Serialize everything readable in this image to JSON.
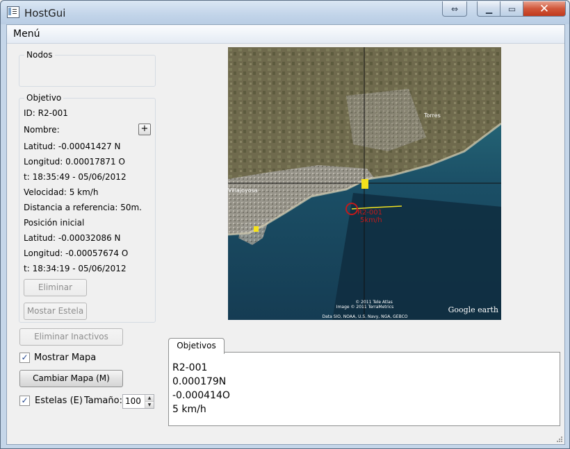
{
  "window": {
    "title": "HostGui"
  },
  "menu": {
    "items": [
      "Menú"
    ]
  },
  "nodos": {
    "title": "Nodos"
  },
  "objetivo": {
    "title": "Objetivo",
    "id": "ID: R2-001",
    "nombre": "Nombre:",
    "add_label": "+",
    "latitud": "Latitud: -0.00041427 N",
    "longitud": "Longitud: 0.00017871 O",
    "tiempo": "t: 18:35:49 - 05/06/2012",
    "velocidad": "Velocidad: 5 km/h",
    "distancia": "Distancia a referencia: 50m.",
    "posicion_inicial": "Posición inicial",
    "latitud_inicial": "Latitud: -0.00032086 N",
    "longitud_inicial": "Longitud: -0.00057674 O",
    "tiempo_inicial": "t: 18:34:19 - 05/06/2012",
    "eliminar_label": "Eliminar",
    "mostrar_estela_label": "Mostar Estela"
  },
  "controls": {
    "eliminar_inactivos_label": "Eliminar Inactivos",
    "mostrar_mapa_label": "Mostrar Mapa",
    "mostrar_mapa_checked": true,
    "cambiar_mapa_label": "Cambiar Mapa (M)",
    "estelas_label": "Estelas (E)",
    "estelas_checked": true,
    "tamano_label": "Tamaño:",
    "tamano_value": "100"
  },
  "map": {
    "place_1": "Villajoyosa",
    "place_2": "Torres",
    "marker_label": "R2-001",
    "speed_label": "5km/h",
    "copyright_1": "© 2011 Tele Atlas",
    "copyright_2": "Image © 2011 TerraMetrics",
    "copyright_3": "Data SIO, NOAA, U.S. Navy, NGA, GEBCO",
    "brand": "Google earth"
  },
  "tabs": {
    "items": [
      {
        "label": "Objetivos"
      }
    ],
    "lines": [
      "R2-001",
      "0.000179N",
      "-0.000414O",
      "5 km/h"
    ]
  },
  "colors": {
    "titlebar": "#c2d4e9",
    "close_button": "#c8462a",
    "marker": "#c41a1a",
    "trail": "#f0e020"
  }
}
